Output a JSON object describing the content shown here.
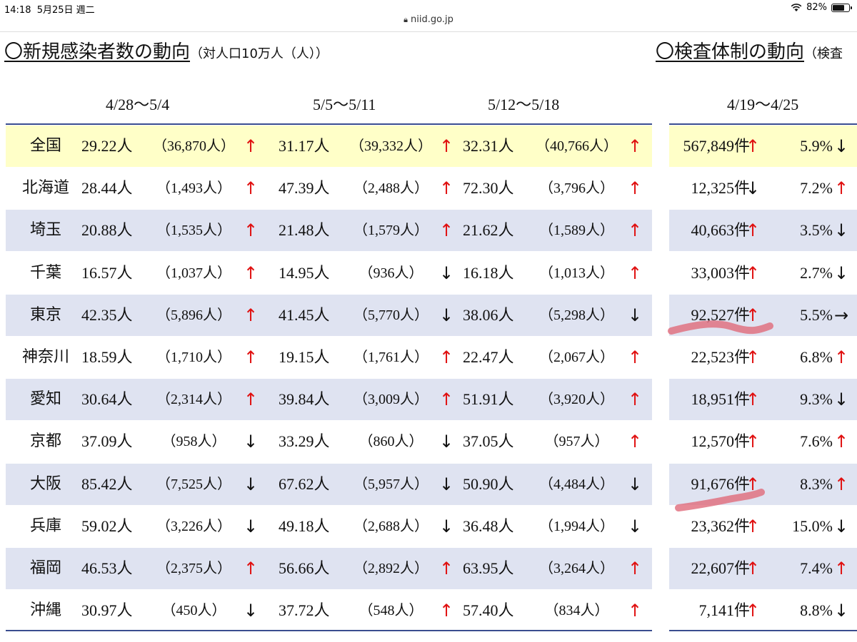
{
  "status_bar": {
    "time": "14:18",
    "date": "5月25日 週二",
    "battery": "82%",
    "battery_level": 0.82
  },
  "browser": {
    "url": "niid.go.jp"
  },
  "left_title": {
    "main": "〇新規感染者数の動向",
    "sub": "（対人口10万人（人））"
  },
  "right_title": {
    "main": "〇検査体制の動向",
    "sub": "（検査"
  },
  "periods": [
    "4/28～5/4",
    "5/5～5/11",
    "5/12～5/18"
  ],
  "right_period": "4/19～4/25",
  "colors": {
    "up": "#e01010",
    "down": "#111111",
    "rule": "#3a4d8f",
    "yellow_row": "#ffffc8",
    "blue_row": "#dfe3f1"
  },
  "rows": [
    {
      "pref": "全国",
      "w1": {
        "rate": "29.22人",
        "count": "（36,870人）",
        "arrow": "↑",
        "dir": "up"
      },
      "w2": {
        "rate": "31.17人",
        "count": "（39,332人）",
        "arrow": "↑",
        "dir": "up"
      },
      "w3": {
        "rate": "32.31人",
        "count": "（40,766人）",
        "arrow": "↑",
        "dir": "up"
      },
      "tests": {
        "count": "567,849件",
        "count_arrow": "↑",
        "count_dir": "up",
        "pos": "5.9%",
        "pos_arrow": "↓",
        "pos_dir": "down"
      }
    },
    {
      "pref": "北海道",
      "w1": {
        "rate": "28.44人",
        "count": "（1,493人）",
        "arrow": "↑",
        "dir": "up"
      },
      "w2": {
        "rate": "47.39人",
        "count": "（2,488人）",
        "arrow": "↑",
        "dir": "up"
      },
      "w3": {
        "rate": "72.30人",
        "count": "（3,796人）",
        "arrow": "↑",
        "dir": "up"
      },
      "tests": {
        "count": "12,325件",
        "count_arrow": "↓",
        "count_dir": "down",
        "pos": "7.2%",
        "pos_arrow": "↑",
        "pos_dir": "up"
      }
    },
    {
      "pref": "埼玉",
      "w1": {
        "rate": "20.88人",
        "count": "（1,535人）",
        "arrow": "↑",
        "dir": "up"
      },
      "w2": {
        "rate": "21.48人",
        "count": "（1,579人）",
        "arrow": "↑",
        "dir": "up"
      },
      "w3": {
        "rate": "21.62人",
        "count": "（1,589人）",
        "arrow": "↑",
        "dir": "up"
      },
      "tests": {
        "count": "40,663件",
        "count_arrow": "↑",
        "count_dir": "up",
        "pos": "3.5%",
        "pos_arrow": "↓",
        "pos_dir": "down"
      }
    },
    {
      "pref": "千葉",
      "w1": {
        "rate": "16.57人",
        "count": "（1,037人）",
        "arrow": "↑",
        "dir": "up"
      },
      "w2": {
        "rate": "14.95人",
        "count": "（936人）",
        "arrow": "↓",
        "dir": "down"
      },
      "w3": {
        "rate": "16.18人",
        "count": "（1,013人）",
        "arrow": "↑",
        "dir": "up"
      },
      "tests": {
        "count": "33,003件",
        "count_arrow": "↑",
        "count_dir": "up",
        "pos": "2.7%",
        "pos_arrow": "↓",
        "pos_dir": "down"
      }
    },
    {
      "pref": "東京",
      "w1": {
        "rate": "42.35人",
        "count": "（5,896人）",
        "arrow": "↑",
        "dir": "up"
      },
      "w2": {
        "rate": "41.45人",
        "count": "（5,770人）",
        "arrow": "↓",
        "dir": "down"
      },
      "w3": {
        "rate": "38.06人",
        "count": "（5,298人）",
        "arrow": "↓",
        "dir": "down"
      },
      "tests": {
        "count": "92,527件",
        "count_arrow": "↑",
        "count_dir": "up",
        "pos": "5.5%",
        "pos_arrow": "→",
        "pos_dir": "right"
      }
    },
    {
      "pref": "神奈川",
      "w1": {
        "rate": "18.59人",
        "count": "（1,710人）",
        "arrow": "↑",
        "dir": "up"
      },
      "w2": {
        "rate": "19.15人",
        "count": "（1,761人）",
        "arrow": "↑",
        "dir": "up"
      },
      "w3": {
        "rate": "22.47人",
        "count": "（2,067人）",
        "arrow": "↑",
        "dir": "up"
      },
      "tests": {
        "count": "22,523件",
        "count_arrow": "↑",
        "count_dir": "up",
        "pos": "6.8%",
        "pos_arrow": "↑",
        "pos_dir": "up"
      }
    },
    {
      "pref": "愛知",
      "w1": {
        "rate": "30.64人",
        "count": "（2,314人）",
        "arrow": "↑",
        "dir": "up"
      },
      "w2": {
        "rate": "39.84人",
        "count": "（3,009人）",
        "arrow": "↑",
        "dir": "up"
      },
      "w3": {
        "rate": "51.91人",
        "count": "（3,920人）",
        "arrow": "↑",
        "dir": "up"
      },
      "tests": {
        "count": "18,951件",
        "count_arrow": "↑",
        "count_dir": "up",
        "pos": "9.3%",
        "pos_arrow": "↓",
        "pos_dir": "down"
      }
    },
    {
      "pref": "京都",
      "w1": {
        "rate": "37.09人",
        "count": "（958人）",
        "arrow": "↓",
        "dir": "down"
      },
      "w2": {
        "rate": "33.29人",
        "count": "（860人）",
        "arrow": "↓",
        "dir": "down"
      },
      "w3": {
        "rate": "37.05人",
        "count": "（957人）",
        "arrow": "↑",
        "dir": "up"
      },
      "tests": {
        "count": "12,570件",
        "count_arrow": "↑",
        "count_dir": "up",
        "pos": "7.6%",
        "pos_arrow": "↑",
        "pos_dir": "up"
      }
    },
    {
      "pref": "大阪",
      "w1": {
        "rate": "85.42人",
        "count": "（7,525人）",
        "arrow": "↓",
        "dir": "down"
      },
      "w2": {
        "rate": "67.62人",
        "count": "（5,957人）",
        "arrow": "↓",
        "dir": "down"
      },
      "w3": {
        "rate": "50.90人",
        "count": "（4,484人）",
        "arrow": "↓",
        "dir": "down"
      },
      "tests": {
        "count": "91,676件",
        "count_arrow": "↑",
        "count_dir": "up",
        "pos": "8.3%",
        "pos_arrow": "↑",
        "pos_dir": "up"
      }
    },
    {
      "pref": "兵庫",
      "w1": {
        "rate": "59.02人",
        "count": "（3,226人）",
        "arrow": "↓",
        "dir": "down"
      },
      "w2": {
        "rate": "49.18人",
        "count": "（2,688人）",
        "arrow": "↓",
        "dir": "down"
      },
      "w3": {
        "rate": "36.48人",
        "count": "（1,994人）",
        "arrow": "↓",
        "dir": "down"
      },
      "tests": {
        "count": "23,362件",
        "count_arrow": "↑",
        "count_dir": "up",
        "pos": "15.0%",
        "pos_arrow": "↓",
        "pos_dir": "down"
      }
    },
    {
      "pref": "福岡",
      "w1": {
        "rate": "46.53人",
        "count": "（2,375人）",
        "arrow": "↑",
        "dir": "up"
      },
      "w2": {
        "rate": "56.66人",
        "count": "（2,892人）",
        "arrow": "↑",
        "dir": "up"
      },
      "w3": {
        "rate": "63.95人",
        "count": "（3,264人）",
        "arrow": "↑",
        "dir": "up"
      },
      "tests": {
        "count": "22,607件",
        "count_arrow": "↑",
        "count_dir": "up",
        "pos": "7.4%",
        "pos_arrow": "↑",
        "pos_dir": "up"
      }
    },
    {
      "pref": "沖縄",
      "w1": {
        "rate": "30.97人",
        "count": "（450人）",
        "arrow": "↓",
        "dir": "down"
      },
      "w2": {
        "rate": "37.72人",
        "count": "（548人）",
        "arrow": "↑",
        "dir": "up"
      },
      "w3": {
        "rate": "57.40人",
        "count": "（834人）",
        "arrow": "↑",
        "dir": "up"
      },
      "tests": {
        "count": "7,141件",
        "count_arrow": "↑",
        "count_dir": "up",
        "pos": "8.8%",
        "pos_arrow": "↓",
        "pos_dir": "down"
      }
    }
  ]
}
